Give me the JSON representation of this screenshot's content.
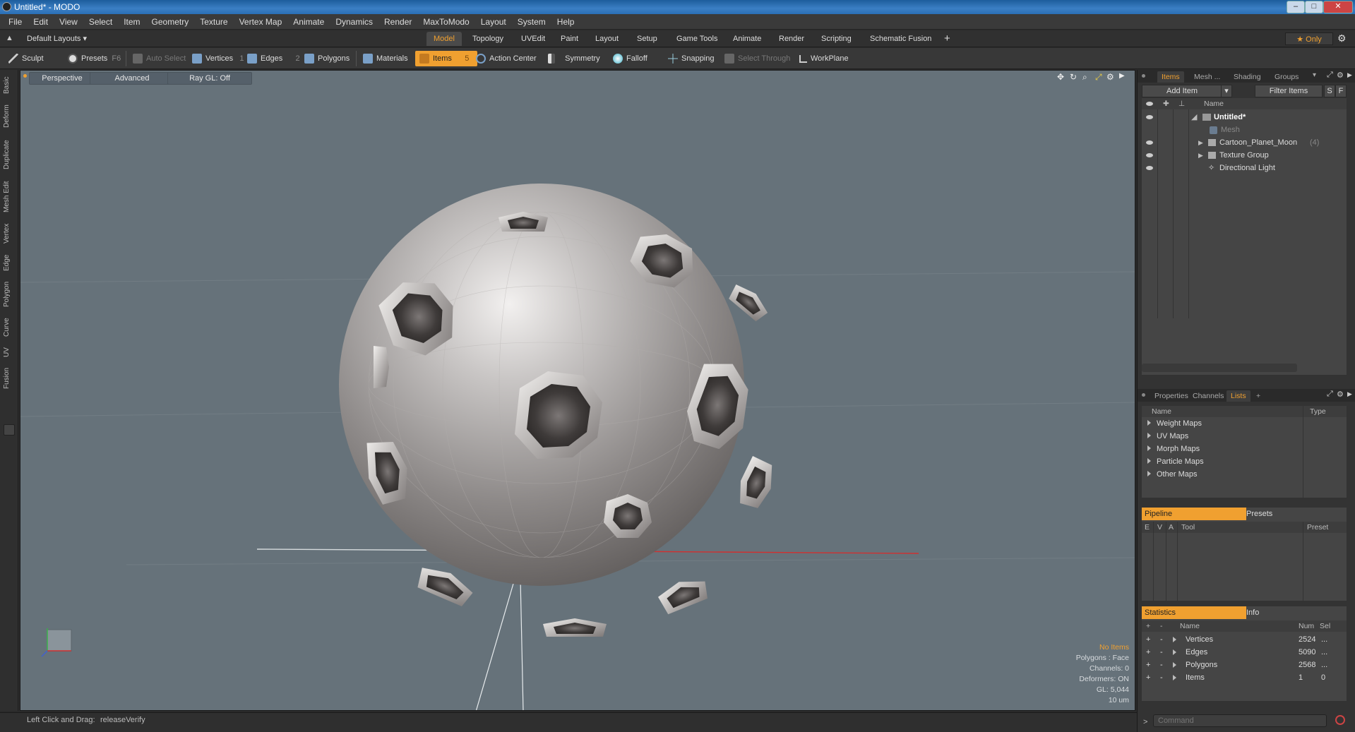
{
  "window": {
    "title": "Untitled* - MODO"
  },
  "menu": [
    "File",
    "Edit",
    "View",
    "Select",
    "Item",
    "Geometry",
    "Texture",
    "Vertex Map",
    "Animate",
    "Dynamics",
    "Render",
    "MaxToModo",
    "Layout",
    "System",
    "Help"
  ],
  "layout_selector": "Default Layouts",
  "layout_tabs": [
    "Model",
    "Topology",
    "UVEdit",
    "Paint",
    "Layout",
    "Setup",
    "Game Tools",
    "Animate",
    "Render",
    "Scripting",
    "Schematic Fusion"
  ],
  "layout_add": "+",
  "only_label": "Only",
  "toolbar": {
    "sculpt": "Sculpt",
    "presets": "Presets",
    "presets_key": "F6",
    "auto_select": "Auto Select",
    "vertices": "Vertices",
    "vertices_key": "1",
    "edges": "Edges",
    "edges_key": "2",
    "polygons": "Polygons",
    "materials": "Materials",
    "items": "Items",
    "items_key": "5",
    "action_center": "Action Center",
    "symmetry": "Symmetry",
    "falloff": "Falloff",
    "snapping": "Snapping",
    "select_through": "Select Through",
    "workplane": "WorkPlane"
  },
  "left_tabs": [
    "Basic",
    "Deform",
    "Duplicate",
    "Mesh Edit",
    "Vertex",
    "Edge",
    "Polygon",
    "Curve",
    "UV",
    "Fusion"
  ],
  "viewport": {
    "view": "Perspective",
    "advanced": "Advanced",
    "raygl": "Ray GL: Off",
    "info": {
      "no_items": "No Items",
      "polygons": "Polygons : Face",
      "channels": "Channels: 0",
      "deformers": "Deformers: ON",
      "gl": "GL: 5,044",
      "scale": "10 um"
    }
  },
  "statusbar": {
    "hint": "Left Click and Drag:",
    "action": "releaseVerify"
  },
  "items_panel": {
    "tabs": [
      "Items",
      "Mesh ...",
      "Shading",
      "Groups"
    ],
    "add_item": "Add Item",
    "filter_items": "Filter Items",
    "s_btn": "S",
    "f_btn": "F",
    "name_header": "Name",
    "tree": [
      {
        "label": "Untitled*",
        "count": ""
      },
      {
        "label": "Mesh",
        "count": ""
      },
      {
        "label": "Cartoon_Planet_Moon",
        "count": "(4)"
      },
      {
        "label": "Texture Group",
        "count": ""
      },
      {
        "label": "Directional Light",
        "count": ""
      }
    ]
  },
  "lists_panel": {
    "tabs": [
      "Properties",
      "Channels",
      "Lists"
    ],
    "add": "+",
    "headers": {
      "name": "Name",
      "type": "Type"
    },
    "rows": [
      "Weight Maps",
      "UV Maps",
      "Morph Maps",
      "Particle Maps",
      "Other Maps"
    ]
  },
  "pipeline_panel": {
    "tabs": [
      "Pipeline",
      "Presets"
    ],
    "headers": {
      "e": "E",
      "v": "V",
      "a": "A",
      "tool": "Tool",
      "preset": "Preset"
    }
  },
  "stats_panel": {
    "tabs": [
      "Statistics",
      "Info"
    ],
    "headers": {
      "plus": "+",
      "minus": "-",
      "name": "Name",
      "num": "Num",
      "sel": "Sel"
    },
    "rows": [
      {
        "name": "Vertices",
        "num": "2524",
        "sel": "..."
      },
      {
        "name": "Edges",
        "num": "5090",
        "sel": "..."
      },
      {
        "name": "Polygons",
        "num": "2568",
        "sel": "..."
      },
      {
        "name": "Items",
        "num": "1",
        "sel": "0"
      }
    ]
  },
  "command": {
    "prompt": ">",
    "placeholder": "Command"
  },
  "colors": {
    "accent": "#f0a030",
    "viewport_bg": "#66727a",
    "x_axis": "#d03030"
  }
}
